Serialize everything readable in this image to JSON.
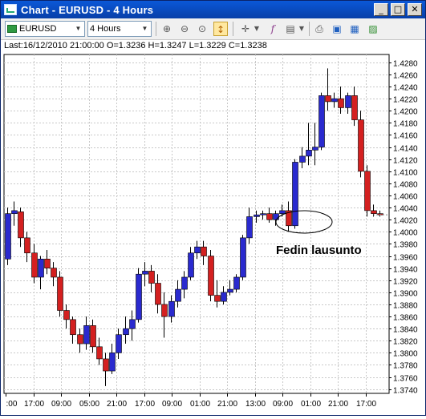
{
  "window": {
    "title": "Chart - EURUSD - 4 Hours",
    "buttons": {
      "minimize": "_",
      "maximize": "□",
      "close": "✕"
    }
  },
  "toolbar": {
    "symbol": "EURUSD",
    "timeframe": "4 Hours",
    "icons": [
      "zoom-in-icon",
      "zoom-out-icon",
      "zoom-reset-icon",
      "cursor-sync-icon",
      "crosshair-icon",
      "function-icon",
      "template-icon",
      "print-icon",
      "save-icon",
      "properties-icon",
      "export-icon"
    ]
  },
  "info": {
    "text": "Last:16/12/2010 21:00:00 O=1.3236 H=1.3247 L=1.3229 C=1.3238"
  },
  "annotation": {
    "text": "Fedin lausunto"
  },
  "colors": {
    "up": "#2a2acf",
    "down": "#d42020",
    "grid": "#c8c8c8",
    "axis": "#000000"
  },
  "chart_data": {
    "type": "candlestick",
    "yaxis": {
      "ticks": [
        1.428,
        1.426,
        1.424,
        1.422,
        1.42,
        1.418,
        1.416,
        1.414,
        1.412,
        1.41,
        1.408,
        1.406,
        1.404,
        1.402,
        1.4,
        1.398,
        1.396,
        1.394,
        1.392,
        1.39,
        1.388,
        1.386,
        1.384,
        1.382,
        1.38,
        1.378,
        1.376,
        1.374
      ],
      "ylim": [
        1.3733,
        1.4293
      ]
    },
    "xaxis": {
      "tick_labels": [
        ":00",
        "17:00",
        "09:00",
        "05:00",
        "21:00",
        "17:00",
        "09:00",
        "01:00",
        "21:00",
        "13:00",
        "09:00",
        "01:00",
        "21:00",
        "17:00"
      ]
    },
    "current_price": 1.4028,
    "candles": [
      {
        "o": 1.3955,
        "h": 1.404,
        "l": 1.3945,
        "c": 1.403
      },
      {
        "o": 1.403,
        "h": 1.405,
        "l": 1.401,
        "c": 1.4035
      },
      {
        "o": 1.4033,
        "h": 1.404,
        "l": 1.3975,
        "c": 1.399
      },
      {
        "o": 1.399,
        "h": 1.4,
        "l": 1.395,
        "c": 1.3965
      },
      {
        "o": 1.3965,
        "h": 1.398,
        "l": 1.3915,
        "c": 1.3925
      },
      {
        "o": 1.3925,
        "h": 1.396,
        "l": 1.3905,
        "c": 1.3955
      },
      {
        "o": 1.3955,
        "h": 1.397,
        "l": 1.393,
        "c": 1.394
      },
      {
        "o": 1.394,
        "h": 1.395,
        "l": 1.391,
        "c": 1.3925
      },
      {
        "o": 1.3925,
        "h": 1.3935,
        "l": 1.386,
        "c": 1.387
      },
      {
        "o": 1.387,
        "h": 1.388,
        "l": 1.384,
        "c": 1.3855
      },
      {
        "o": 1.3855,
        "h": 1.386,
        "l": 1.3815,
        "c": 1.383
      },
      {
        "o": 1.383,
        "h": 1.384,
        "l": 1.38,
        "c": 1.3815
      },
      {
        "o": 1.3815,
        "h": 1.386,
        "l": 1.3805,
        "c": 1.3845
      },
      {
        "o": 1.3845,
        "h": 1.3855,
        "l": 1.38,
        "c": 1.381
      },
      {
        "o": 1.381,
        "h": 1.3825,
        "l": 1.378,
        "c": 1.379
      },
      {
        "o": 1.379,
        "h": 1.38,
        "l": 1.3745,
        "c": 1.377
      },
      {
        "o": 1.377,
        "h": 1.3815,
        "l": 1.3765,
        "c": 1.38
      },
      {
        "o": 1.38,
        "h": 1.384,
        "l": 1.379,
        "c": 1.383
      },
      {
        "o": 1.383,
        "h": 1.386,
        "l": 1.3815,
        "c": 1.384
      },
      {
        "o": 1.384,
        "h": 1.387,
        "l": 1.382,
        "c": 1.3855
      },
      {
        "o": 1.3855,
        "h": 1.394,
        "l": 1.385,
        "c": 1.393
      },
      {
        "o": 1.393,
        "h": 1.395,
        "l": 1.391,
        "c": 1.3935
      },
      {
        "o": 1.3935,
        "h": 1.3945,
        "l": 1.39,
        "c": 1.3915
      },
      {
        "o": 1.3915,
        "h": 1.393,
        "l": 1.3865,
        "c": 1.388
      },
      {
        "o": 1.388,
        "h": 1.39,
        "l": 1.3825,
        "c": 1.386
      },
      {
        "o": 1.386,
        "h": 1.3895,
        "l": 1.385,
        "c": 1.3885
      },
      {
        "o": 1.3885,
        "h": 1.392,
        "l": 1.3875,
        "c": 1.3905
      },
      {
        "o": 1.3905,
        "h": 1.3935,
        "l": 1.389,
        "c": 1.3925
      },
      {
        "o": 1.3925,
        "h": 1.3975,
        "l": 1.392,
        "c": 1.3965
      },
      {
        "o": 1.3965,
        "h": 1.3985,
        "l": 1.3955,
        "c": 1.3975
      },
      {
        "o": 1.3975,
        "h": 1.3985,
        "l": 1.3945,
        "c": 1.396
      },
      {
        "o": 1.396,
        "h": 1.397,
        "l": 1.3885,
        "c": 1.3895
      },
      {
        "o": 1.3895,
        "h": 1.392,
        "l": 1.3875,
        "c": 1.3885
      },
      {
        "o": 1.3885,
        "h": 1.391,
        "l": 1.388,
        "c": 1.39
      },
      {
        "o": 1.39,
        "h": 1.392,
        "l": 1.3895,
        "c": 1.3905
      },
      {
        "o": 1.3905,
        "h": 1.393,
        "l": 1.39,
        "c": 1.3925
      },
      {
        "o": 1.3925,
        "h": 1.3995,
        "l": 1.392,
        "c": 1.399
      },
      {
        "o": 1.399,
        "h": 1.404,
        "l": 1.398,
        "c": 1.4025
      },
      {
        "o": 1.4025,
        "h": 1.4035,
        "l": 1.4015,
        "c": 1.4028
      },
      {
        "o": 1.4028,
        "h": 1.4035,
        "l": 1.402,
        "c": 1.403
      },
      {
        "o": 1.403,
        "h": 1.404,
        "l": 1.4015,
        "c": 1.402
      },
      {
        "o": 1.402,
        "h": 1.4035,
        "l": 1.401,
        "c": 1.403
      },
      {
        "o": 1.403,
        "h": 1.4045,
        "l": 1.4025,
        "c": 1.4035
      },
      {
        "o": 1.4035,
        "h": 1.405,
        "l": 1.4,
        "c": 1.401
      },
      {
        "o": 1.401,
        "h": 1.412,
        "l": 1.4005,
        "c": 1.4115
      },
      {
        "o": 1.4115,
        "h": 1.414,
        "l": 1.4105,
        "c": 1.4125
      },
      {
        "o": 1.4125,
        "h": 1.418,
        "l": 1.411,
        "c": 1.4135
      },
      {
        "o": 1.4135,
        "h": 1.418,
        "l": 1.411,
        "c": 1.414
      },
      {
        "o": 1.414,
        "h": 1.423,
        "l": 1.4135,
        "c": 1.4225
      },
      {
        "o": 1.4225,
        "h": 1.427,
        "l": 1.42,
        "c": 1.4215
      },
      {
        "o": 1.4215,
        "h": 1.423,
        "l": 1.4205,
        "c": 1.422
      },
      {
        "o": 1.422,
        "h": 1.424,
        "l": 1.4195,
        "c": 1.4205
      },
      {
        "o": 1.4205,
        "h": 1.423,
        "l": 1.4195,
        "c": 1.4225
      },
      {
        "o": 1.4225,
        "h": 1.424,
        "l": 1.4175,
        "c": 1.4185
      },
      {
        "o": 1.4185,
        "h": 1.42,
        "l": 1.409,
        "c": 1.41
      },
      {
        "o": 1.41,
        "h": 1.411,
        "l": 1.4025,
        "c": 1.4035
      },
      {
        "o": 1.4035,
        "h": 1.4045,
        "l": 1.4025,
        "c": 1.403
      },
      {
        "o": 1.403,
        "h": 1.4035,
        "l": 1.4025,
        "c": 1.4028
      }
    ]
  }
}
